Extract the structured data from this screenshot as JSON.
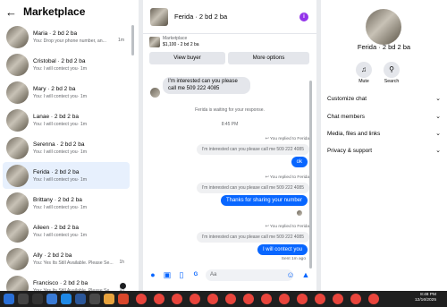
{
  "left": {
    "back_icon": "arrow-left-icon",
    "title": "Marketplace",
    "conversations": [
      {
        "name": "Maria · 2 bd 2 ba",
        "preview": "You: Drop your phone number, an...",
        "time": "1m",
        "active": false,
        "dot": false
      },
      {
        "name": "Cristobal · 2 bd 2 ba",
        "preview": "You: I will contect you· 1m",
        "time": "",
        "active": false,
        "dot": false
      },
      {
        "name": "Mary · 2 bd 2 ba",
        "preview": "You: I will contect you· 1m",
        "time": "",
        "active": false,
        "dot": false
      },
      {
        "name": "Lanae · 2 bd 2 ba",
        "preview": "You: I will contect you· 1m",
        "time": "",
        "active": false,
        "dot": false
      },
      {
        "name": "Serenna · 2 bd 2 ba",
        "preview": "You: I will contect you· 1m",
        "time": "",
        "active": false,
        "dot": false
      },
      {
        "name": "Ferida · 2 bd 2 ba",
        "preview": "You: I will contect you· 1m",
        "time": "",
        "active": true,
        "dot": false
      },
      {
        "name": "Brittany · 2 bd 2 ba",
        "preview": "You: I will contect you· 1m",
        "time": "",
        "active": false,
        "dot": false
      },
      {
        "name": "Aileen · 2 bd 2 ba",
        "preview": "You: I will contect you· 1m",
        "time": "",
        "active": false,
        "dot": false
      },
      {
        "name": "Ally · 2 bd 2 ba",
        "preview": "You: Yes Its Still Available. Please Se...",
        "time": "1h",
        "active": false,
        "dot": false
      },
      {
        "name": "Francisco · 2 bd 2 ba",
        "preview": "You: Yes Its Still Available. Please Se...",
        "time": "1h",
        "active": false,
        "dot": true
      }
    ]
  },
  "chat": {
    "title": "Ferida · 2 bd 2 ba",
    "info_icon": "info-icon",
    "listing_label": "Marketplace",
    "listing_price": "$1,100 - 2 bd 2 ba",
    "view_buyer": "View buyer",
    "more_options": "More options",
    "incoming": "I'm interested can you please call me 509 222 4085",
    "waiting": "Ferida is waiting for your response.",
    "time_divider": "8:45 PM",
    "replies": [
      {
        "replied": "You replied to Ferida",
        "quote": "I'm interested can you please call me 509 222 4085",
        "reply": "ok"
      },
      {
        "replied": "You replied to Ferida",
        "quote": "I'm interested can you please call me 509 222 4085",
        "reply": "Thanks for sharing your number"
      },
      {
        "replied": "You replied to Ferida",
        "quote": "I'm interested can you please call me 509 222 4085",
        "reply": "I will contect you"
      }
    ],
    "sent_label": "Sent 1m ago",
    "input_placeholder": "Aa",
    "composer_icons": [
      "microphone-icon",
      "image-icon",
      "sticker-icon",
      "gif-icon",
      "emoji-icon",
      "thumbs-up-icon"
    ]
  },
  "info": {
    "title": "Ferida · 2 bd 2 ba",
    "mute_label": "Mute",
    "search_label": "Search",
    "sections": [
      "Customize chat",
      "Chat members",
      "Media, files and links",
      "Privacy & support"
    ]
  },
  "taskbar": {
    "time": "8:48 PM",
    "date": "12/16/2025"
  }
}
